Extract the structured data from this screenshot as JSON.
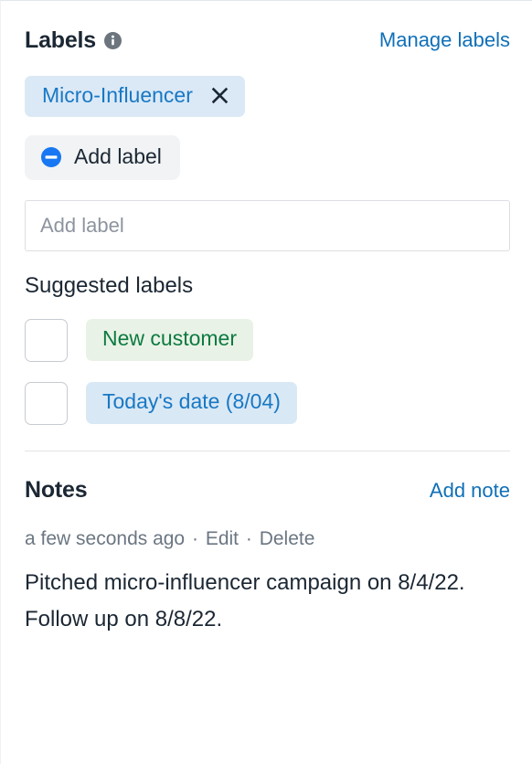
{
  "labels_section": {
    "title": "Labels",
    "info_icon": "info-circle-icon",
    "manage_link": "Manage labels",
    "applied_labels": [
      {
        "text": "Micro-Influencer",
        "remove_icon": "close-x-icon",
        "color": "#1878c4",
        "background": "#dbe9f6"
      }
    ],
    "add_label_button": {
      "label": "Add label",
      "icon": "minus-circle-icon",
      "icon_color": "#1877f2"
    },
    "add_label_input": {
      "value": "",
      "placeholder": "Add label"
    },
    "suggested_title": "Suggested labels",
    "suggested_labels": [
      {
        "text": "New customer",
        "checked": false,
        "text_color": "#0d7a41",
        "background": "#e9f2e6"
      },
      {
        "text": "Today's date (8/04)",
        "checked": false,
        "text_color": "#1878c4",
        "background": "#d9e8f5"
      }
    ]
  },
  "notes_section": {
    "title": "Notes",
    "add_note_link": "Add note",
    "notes": [
      {
        "timestamp": "a few seconds ago",
        "separator": "·",
        "edit_label": "Edit",
        "delete_label": "Delete",
        "body": "Pitched micro-influencer campaign on 8/4/22. Follow up on 8/8/22."
      }
    ]
  },
  "colors": {
    "link_blue": "#1070b8",
    "heading": "#1b2733",
    "muted": "#6b7682",
    "divider": "#e1e4e8",
    "button_bg": "#f1f3f5"
  }
}
